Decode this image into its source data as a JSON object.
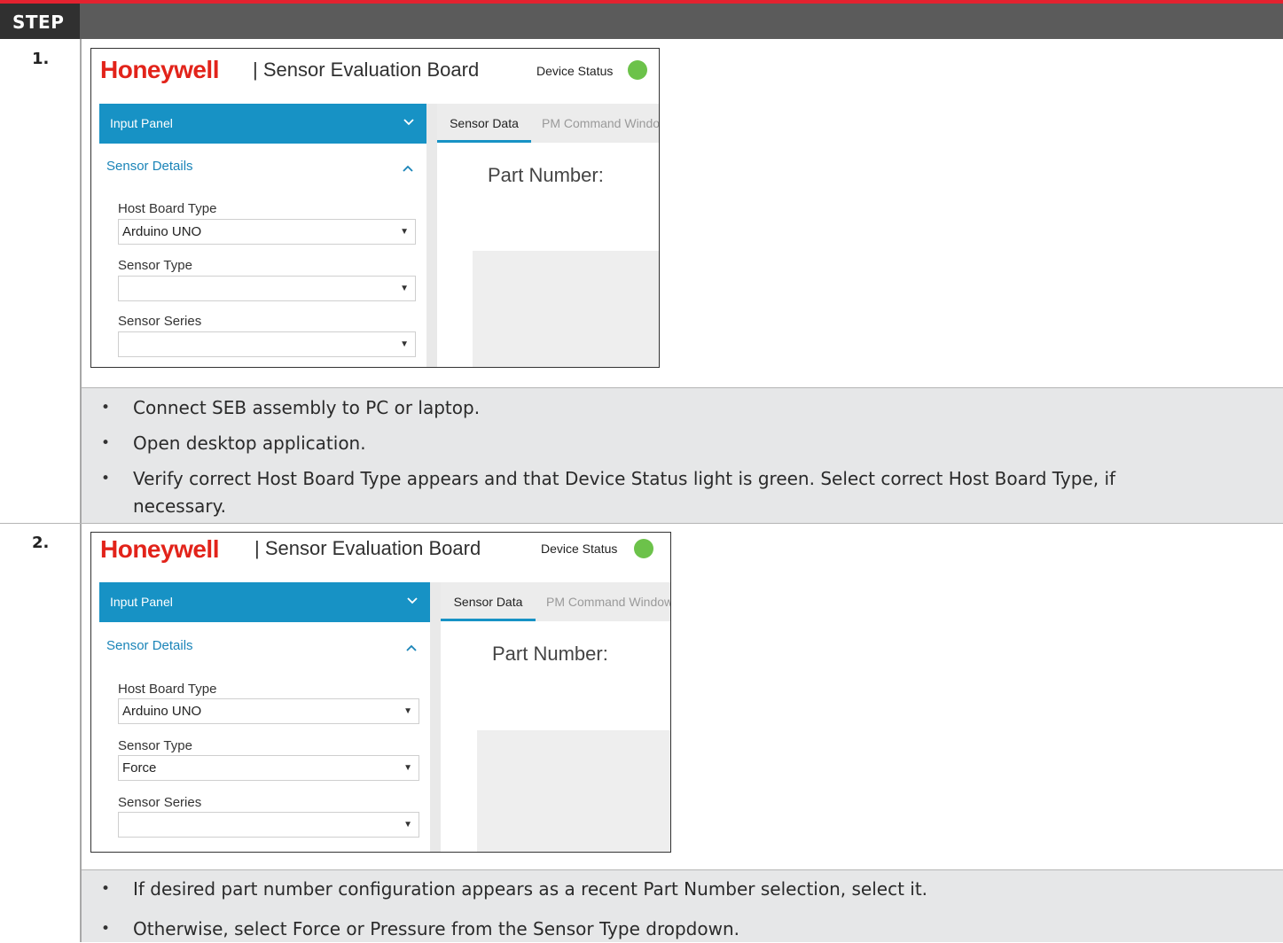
{
  "header": {
    "step_label": "STEP"
  },
  "steps": [
    {
      "number": "1.",
      "app": {
        "logo": "Honeywell",
        "title": "| Sensor Evaluation Board",
        "device_status_label": "Device Status",
        "panel_title": "Input Panel",
        "section_title": "Sensor Details",
        "fields": [
          {
            "label": "Host Board Type",
            "value": "Arduino UNO"
          },
          {
            "label": "Sensor Type",
            "value": ""
          },
          {
            "label": "Sensor Series",
            "value": ""
          }
        ],
        "tabs": {
          "active": "Sensor Data",
          "inactive": "PM Command Window"
        },
        "part_number_label": "Part Number:"
      },
      "bullets": [
        "Connect SEB assembly to PC or laptop.",
        "Open desktop application.",
        "Verify correct Host Board Type appears and that Device Status light is green.  Select correct Host Board Type, if necessary."
      ]
    },
    {
      "number": "2.",
      "app": {
        "logo": "Honeywell",
        "title": "| Sensor Evaluation Board",
        "device_status_label": "Device Status",
        "panel_title": "Input Panel",
        "section_title": "Sensor Details",
        "fields": [
          {
            "label": "Host Board Type",
            "value": "Arduino UNO"
          },
          {
            "label": "Sensor Type",
            "value": "Force"
          },
          {
            "label": "Sensor Series",
            "value": ""
          }
        ],
        "tabs": {
          "active": "Sensor Data",
          "inactive": "PM Command Window"
        },
        "part_number_label": "Part Number:"
      },
      "bullets": [
        "If desired part number configuration appears as a recent Part Number selection, select it.",
        "Otherwise, select Force or Pressure from the Sensor Type dropdown."
      ]
    }
  ],
  "colors": {
    "accent_red": "#e3222f",
    "honeywell_red": "#e2231a",
    "panel_blue": "#1792c5",
    "status_green": "#6cc24a"
  }
}
